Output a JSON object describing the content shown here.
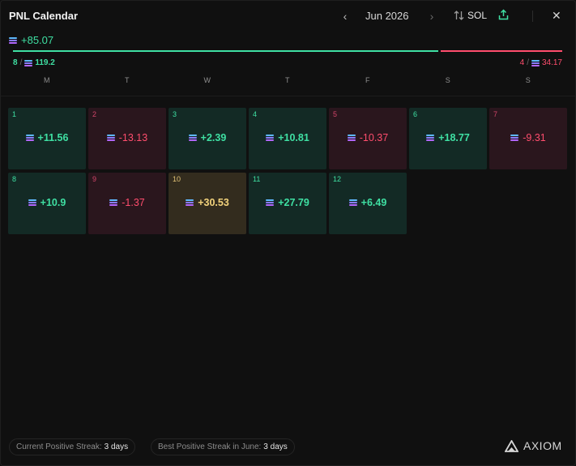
{
  "header": {
    "title": "PNL Calendar",
    "month": "Jun 2026",
    "prev_label": "‹",
    "next_label": "›",
    "currency_label": "SOL",
    "close_label": "✕"
  },
  "summary": {
    "total": "+85.07",
    "wins_count": "8",
    "wins_amount": "119.2",
    "losses_count": "4",
    "losses_amount": "34.17",
    "positive_share": 0.7773,
    "positive_color": "#3fe0a3",
    "negative_color": "#ff4d6d"
  },
  "weekdays": [
    "M",
    "T",
    "W",
    "T",
    "F",
    "S",
    "S"
  ],
  "days": [
    {
      "day": "1",
      "value": "+11.56",
      "status": "positive"
    },
    {
      "day": "2",
      "value": "-13.13",
      "status": "negative"
    },
    {
      "day": "3",
      "value": "+2.39",
      "status": "positive"
    },
    {
      "day": "4",
      "value": "+10.81",
      "status": "positive"
    },
    {
      "day": "5",
      "value": "-10.37",
      "status": "negative"
    },
    {
      "day": "6",
      "value": "+18.77",
      "status": "positive"
    },
    {
      "day": "7",
      "value": "-9.31",
      "status": "negative"
    },
    {
      "day": "8",
      "value": "+10.9",
      "status": "positive"
    },
    {
      "day": "9",
      "value": "-1.37",
      "status": "negative"
    },
    {
      "day": "10",
      "value": "+30.53",
      "status": "best"
    },
    {
      "day": "11",
      "value": "+27.79",
      "status": "positive"
    },
    {
      "day": "12",
      "value": "+6.49",
      "status": "positive"
    }
  ],
  "footer": {
    "current_streak_label": "Current Positive Streak:",
    "current_streak_value": "3 days",
    "best_streak_label": "Best Positive Streak in June:",
    "best_streak_value": "3 days",
    "brand": "AXIOM"
  },
  "icons": {
    "currency": "solana-icon",
    "sort": "sort-arrows-icon",
    "share": "share-upload-icon",
    "brand": "axiom-logo-icon"
  }
}
